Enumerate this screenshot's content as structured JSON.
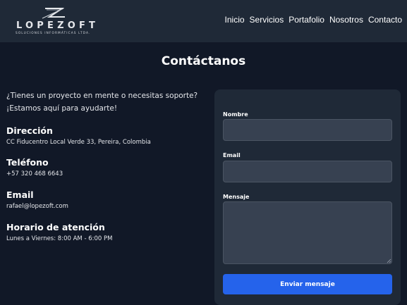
{
  "brand": {
    "name": "LOPEZOFT",
    "tagline": "SOLUCIONES INFORMÁTICAS LTDA."
  },
  "nav": {
    "items": [
      {
        "label": "Inicio"
      },
      {
        "label": "Servicios"
      },
      {
        "label": "Portafolio"
      },
      {
        "label": "Nosotros"
      },
      {
        "label": "Contacto"
      }
    ]
  },
  "contact": {
    "title": "Contáctanos",
    "intro": "¿Tienes un proyecto en mente o necesitas soporte? ¡Estamos aquí para ayudarte!",
    "address": {
      "heading": "Dirección",
      "value": "CC Fiducentro Local Verde 33, Pereira, Colombia"
    },
    "phone": {
      "heading": "Teléfono",
      "value": "+57 320 468 6643"
    },
    "email": {
      "heading": "Email",
      "value": "rafael@lopezoft.com"
    },
    "hours": {
      "heading": "Horario de atención",
      "value": "Lunes a Viernes: 8:00 AM - 6:00 PM"
    }
  },
  "form": {
    "name_label": "Nombre",
    "name_value": "",
    "email_label": "Email",
    "email_value": "",
    "message_label": "Mensaje",
    "message_value": "",
    "submit_label": "Enviar mensaje"
  },
  "colors": {
    "background": "#111827",
    "surface": "#1f2937",
    "input": "#374151",
    "accent": "#2563eb"
  },
  "icons": {
    "logo": "lopezoft-z-logo"
  }
}
